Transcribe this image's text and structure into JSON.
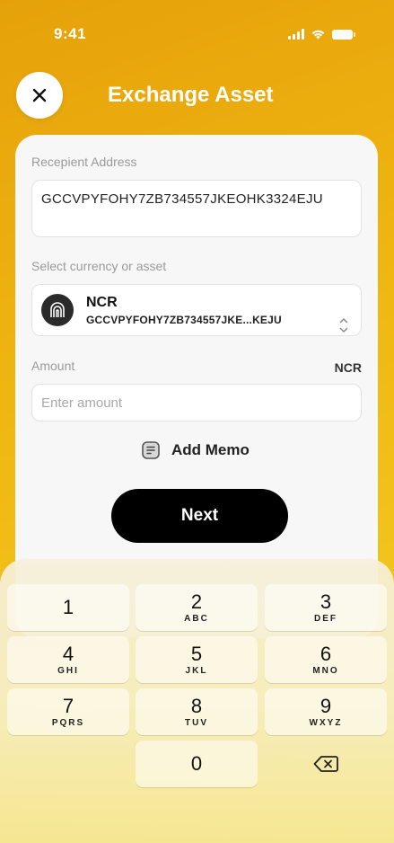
{
  "status": {
    "time": "9:41"
  },
  "header": {
    "title": "Exchange Asset"
  },
  "form": {
    "recipient_label": "Recepient Address",
    "recipient_value": "GCCVPYFOHY7ZB734557JKEOHK3324EJU",
    "currency_label": "Select currency or asset",
    "asset_name": "NCR",
    "asset_address": "GCCVPYFOHY7ZB734557JKE...KEJU",
    "amount_label": "Amount",
    "amount_unit": "NCR",
    "amount_placeholder": "Enter amount",
    "amount_value": "",
    "memo_label": "Add Memo",
    "next_label": "Next"
  },
  "keypad": {
    "keys": [
      {
        "digit": "1",
        "letters": ""
      },
      {
        "digit": "2",
        "letters": "ABC"
      },
      {
        "digit": "3",
        "letters": "DEF"
      },
      {
        "digit": "4",
        "letters": "GHI"
      },
      {
        "digit": "5",
        "letters": "JKL"
      },
      {
        "digit": "6",
        "letters": "MNO"
      },
      {
        "digit": "7",
        "letters": "PQRS"
      },
      {
        "digit": "8",
        "letters": "TUV"
      },
      {
        "digit": "9",
        "letters": "WXYZ"
      },
      {
        "digit": "0",
        "letters": ""
      }
    ],
    "delete_icon": "backspace-icon"
  },
  "colors": {
    "accent": "#f0b812",
    "button": "#000000",
    "card": "#f7f7f7"
  }
}
